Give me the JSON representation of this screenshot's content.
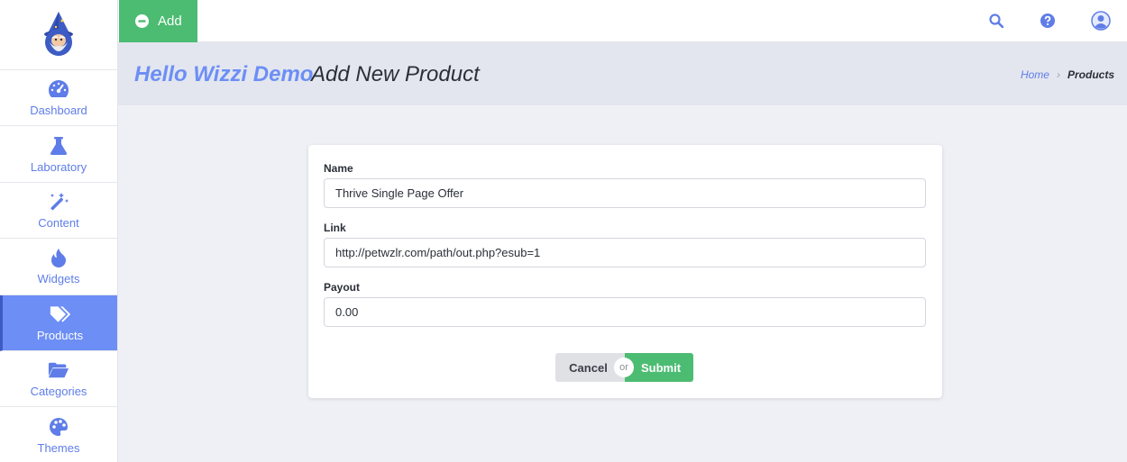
{
  "topbar": {
    "add_label": "Add"
  },
  "header": {
    "brand": "Hello Wizzi Demo",
    "page_title": "Add New Product"
  },
  "breadcrumb": {
    "home": "Home",
    "separator": "›",
    "current": "Products"
  },
  "sidebar": {
    "items": [
      {
        "label": "Dashboard",
        "icon": "gauge-icon"
      },
      {
        "label": "Laboratory",
        "icon": "flask-icon"
      },
      {
        "label": "Content",
        "icon": "magic-wand-icon"
      },
      {
        "label": "Widgets",
        "icon": "fire-icon"
      },
      {
        "label": "Products",
        "icon": "tags-icon",
        "active": true
      },
      {
        "label": "Categories",
        "icon": "folder-open-icon"
      },
      {
        "label": "Themes",
        "icon": "palette-icon"
      }
    ]
  },
  "form": {
    "name": {
      "label": "Name",
      "value": "Thrive Single Page Offer"
    },
    "link": {
      "label": "Link",
      "value": "http://petwzlr.com/path/out.php?esub=1"
    },
    "payout": {
      "label": "Payout",
      "value": "0.00"
    },
    "cancel_label": "Cancel",
    "or_label": "or",
    "submit_label": "Submit"
  },
  "colors": {
    "accent": "#6c8ef5",
    "success": "#4cbc72",
    "titlebar_bg": "#e3e6ef",
    "page_bg": "#eff0f5"
  }
}
